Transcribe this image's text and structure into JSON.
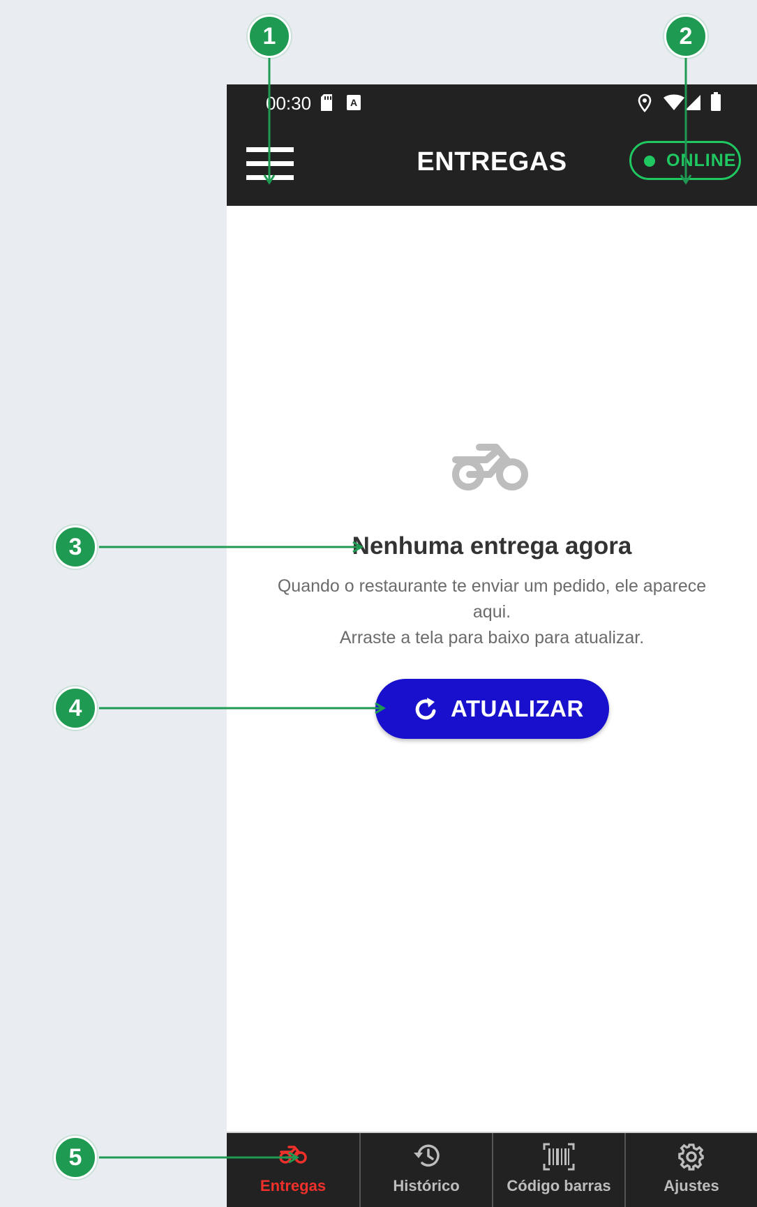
{
  "status_bar": {
    "time": "00:30"
  },
  "app_bar": {
    "title": "ENTREGAS",
    "status_toggle": "ONLINE"
  },
  "empty_state": {
    "title": "Nenhuma entrega agora",
    "description_line1": "Quando o restaurante te enviar um pedido, ele aparece",
    "description_line2": "aqui.",
    "description_line3": "Arraste a tela para baixo para atualizar.",
    "button_label": "ATUALIZAR"
  },
  "bottom_nav": {
    "items": [
      {
        "label": "Entregas",
        "icon": "motorbike-icon",
        "active": true
      },
      {
        "label": "Histórico",
        "icon": "history-icon",
        "active": false
      },
      {
        "label": "Código barras",
        "icon": "barcode-icon",
        "active": false
      },
      {
        "label": "Ajustes",
        "icon": "gear-icon",
        "active": false
      }
    ]
  },
  "annotations": [
    "1",
    "2",
    "3",
    "4",
    "5"
  ],
  "colors": {
    "background": "#e9edf1",
    "bar": "#222222",
    "online": "#1fc860",
    "button": "#1810cc",
    "active_nav": "#f0302a",
    "marker": "#1e9a52"
  }
}
